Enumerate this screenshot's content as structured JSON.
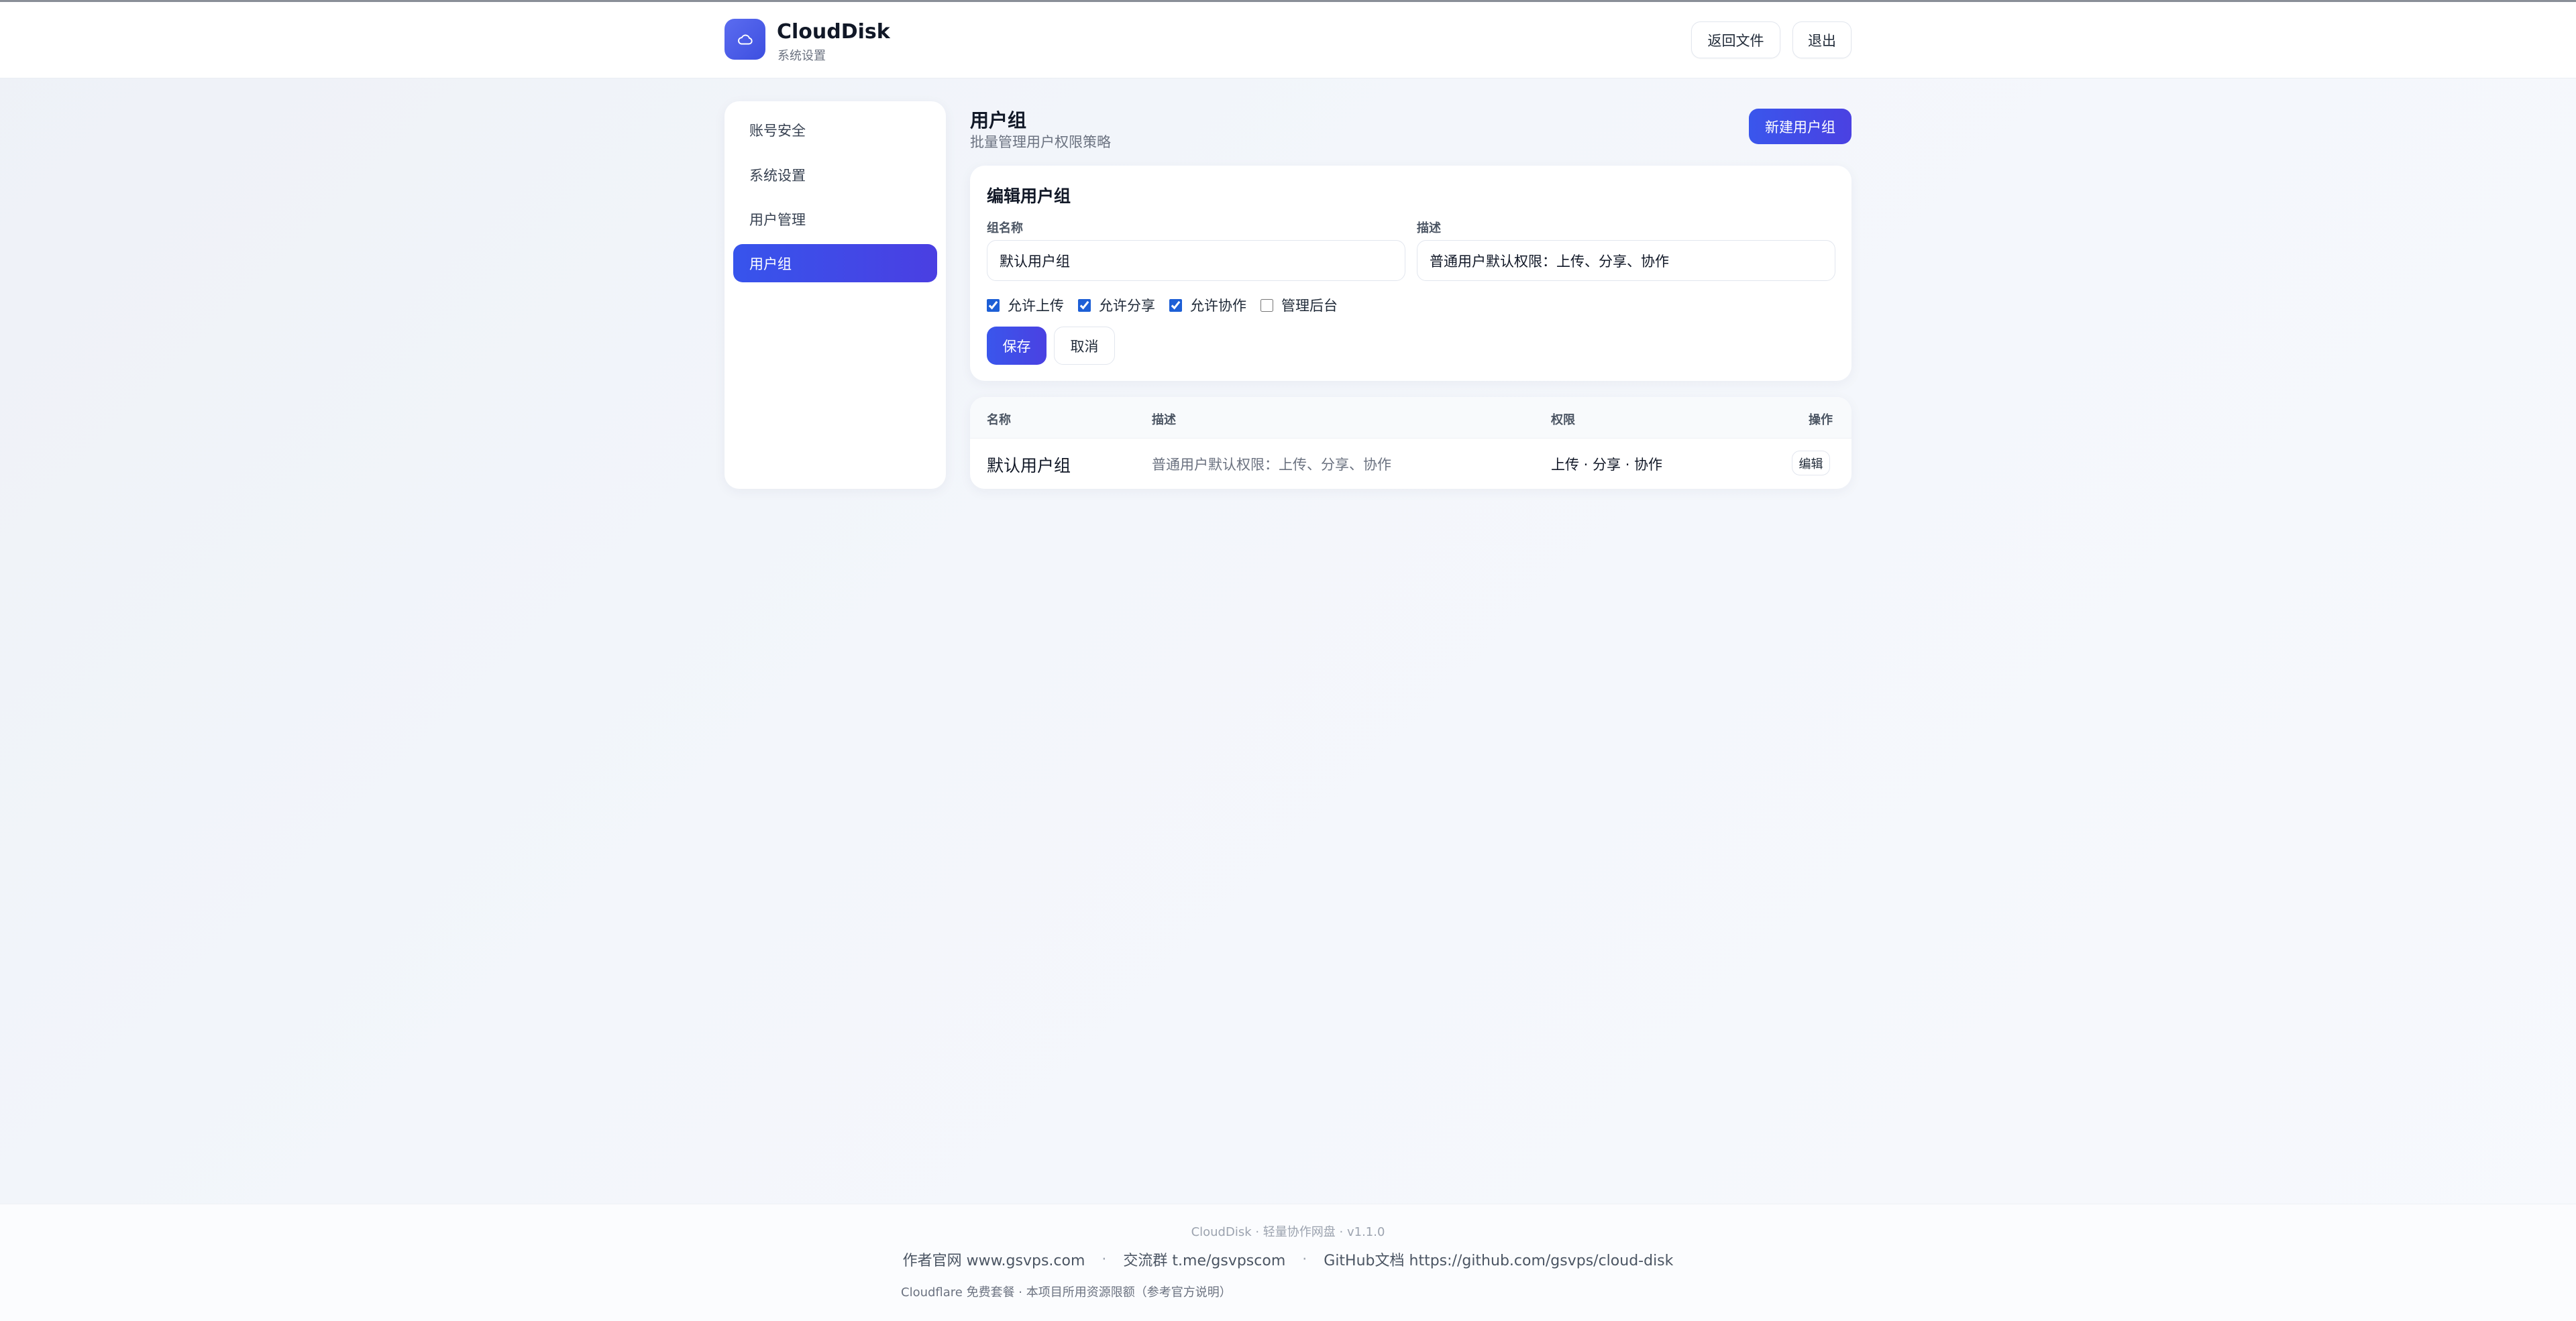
{
  "header": {
    "brand_name": "CloudDisk",
    "brand_sub": "系统设置",
    "back_button": "返回文件",
    "logout_button": "退出",
    "logo_icon": "cloud-icon",
    "accent_color": "#3d4fe0"
  },
  "sidebar": {
    "items": [
      {
        "label": "账号安全",
        "active": false
      },
      {
        "label": "系统设置",
        "active": false
      },
      {
        "label": "用户管理",
        "active": false
      },
      {
        "label": "用户组",
        "active": true
      }
    ]
  },
  "main": {
    "title": "用户组",
    "subtitle": "批量管理用户权限策略",
    "new_button": "新建用户组",
    "edit_form": {
      "title": "编辑用户组",
      "name_label": "组名称",
      "name_value": "默认用户组",
      "desc_label": "描述",
      "desc_value": "普通用户默认权限：上传、分享、协作",
      "permissions": [
        {
          "label": "允许上传",
          "checked": true
        },
        {
          "label": "允许分享",
          "checked": true
        },
        {
          "label": "允许协作",
          "checked": true
        },
        {
          "label": "管理后台",
          "checked": false
        }
      ],
      "save_button": "保存",
      "cancel_button": "取消"
    },
    "table": {
      "headers": [
        "名称",
        "描述",
        "权限",
        "操作"
      ],
      "rows": [
        {
          "name": "默认用户组",
          "desc": "普通用户默认权限：上传、分享、协作",
          "perms": "上传 · 分享 · 协作",
          "action": "编辑"
        }
      ]
    }
  },
  "footer": {
    "version": "CloudDisk · 轻量协作网盘 · v1.1.0",
    "link1": "作者官网 www.gsvps.com",
    "link2": "交流群 t.me/gsvpscom",
    "link3": "GitHub文档 https://github.com/gsvps/cloud-disk",
    "separator": "·",
    "note": "Cloudflare 免费套餐 · 本项目所用资源限额（参考官方说明）"
  }
}
